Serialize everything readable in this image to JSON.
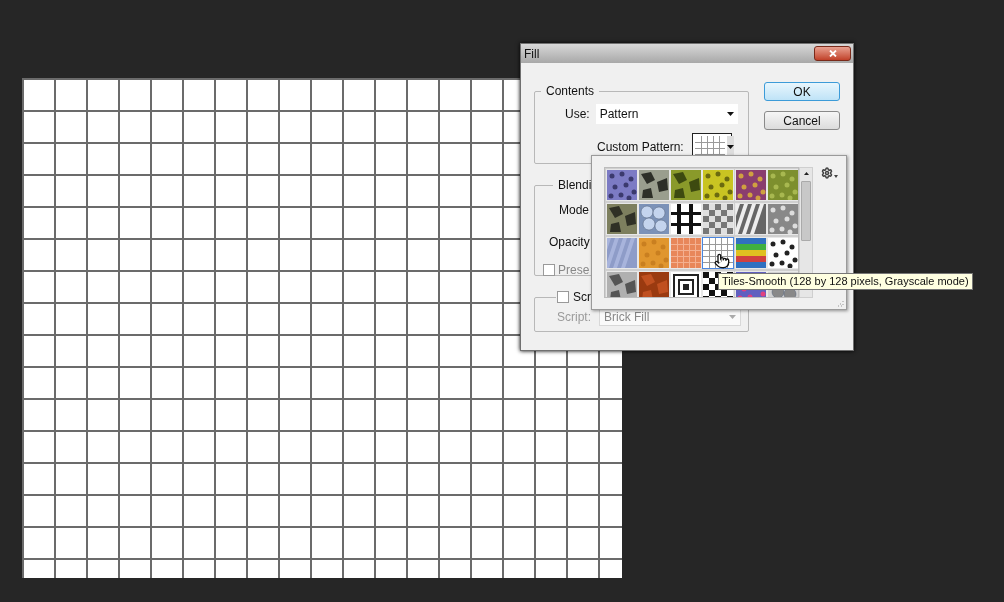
{
  "dialog": {
    "title": "Fill",
    "contents": {
      "legend": "Contents",
      "use_label": "Use:",
      "use_value": "Pattern",
      "custom_pattern_label": "Custom Pattern:"
    },
    "blending": {
      "legend": "Blendi",
      "mode_label": "Mode",
      "opacity_label": "Opacity",
      "preserve": {
        "label": "Prese",
        "checked": false
      }
    },
    "scripted": {
      "label": "Scr",
      "checked": false,
      "script_label": "Script:",
      "script_value": "Brick Fill",
      "disabled": true
    },
    "buttons": [
      {
        "label": "OK",
        "default": true
      },
      {
        "label": "Cancel",
        "default": false
      }
    ]
  },
  "pattern_picker": {
    "patterns": [
      {
        "selected": false
      },
      {
        "selected": false
      },
      {
        "selected": false
      },
      {
        "selected": false
      },
      {
        "selected": false
      },
      {
        "selected": false
      },
      {
        "selected": false
      },
      {
        "selected": false
      },
      {
        "selected": false
      },
      {
        "selected": false
      },
      {
        "selected": false
      },
      {
        "selected": false
      },
      {
        "selected": false
      },
      {
        "selected": false
      },
      {
        "selected": false
      },
      {
        "selected": true
      },
      {
        "selected": false
      },
      {
        "selected": false
      },
      {
        "selected": false
      },
      {
        "selected": false
      },
      {
        "selected": false
      },
      {
        "selected": false
      },
      {
        "selected": false
      },
      {
        "selected": false
      }
    ],
    "tooltip": "Tiles-Smooth (128 by 128 pixels, Grayscale mode)"
  }
}
